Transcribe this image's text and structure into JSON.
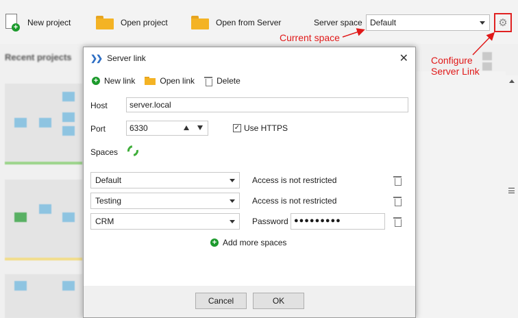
{
  "toolbar": {
    "new_project": "New project",
    "open_project": "Open project",
    "open_from_server": "Open from Server",
    "server_space_label": "Server space",
    "server_space_value": "Default"
  },
  "annotations": {
    "current_space": "Current space",
    "configure_line1": "Configure",
    "configure_line2": "Server Link",
    "color": "#e01818"
  },
  "background": {
    "recent_projects": "Recent projects"
  },
  "dialog": {
    "title": "Server link",
    "tools": {
      "new_link": "New link",
      "open_link": "Open link",
      "delete": "Delete"
    },
    "host_label": "Host",
    "host_value": "server.local",
    "port_label": "Port",
    "port_value": "6330",
    "use_https_label": "Use HTTPS",
    "use_https_checked": true,
    "spaces_label": "Spaces",
    "spaces": [
      {
        "name": "Default",
        "status": "Access is not restricted"
      },
      {
        "name": "Testing",
        "status": "Access is not restricted"
      },
      {
        "name": "CRM",
        "password_label": "Password",
        "password_value": "●●●●●●●●●"
      }
    ],
    "add_more_spaces": "Add more spaces",
    "cancel": "Cancel",
    "ok": "OK"
  }
}
